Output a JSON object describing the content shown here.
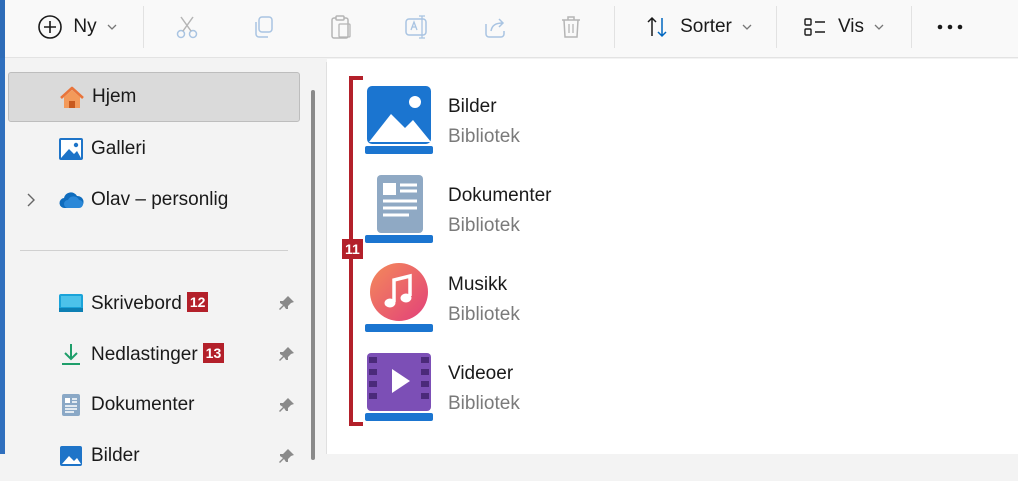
{
  "toolbar": {
    "new_label": "Ny",
    "sort_label": "Sorter",
    "view_label": "Vis",
    "icons": [
      "plus-circle-icon",
      "chevron-down-icon",
      "cut-icon",
      "copy-icon",
      "paste-icon",
      "rename-icon",
      "share-icon",
      "delete-icon",
      "sort-icon",
      "view-icon",
      "more-icon"
    ]
  },
  "sidebar": {
    "items": [
      {
        "label": "Hjem",
        "icon": "home-icon",
        "selected": true
      },
      {
        "label": "Galleri",
        "icon": "gallery-icon"
      },
      {
        "label": "Olav – personlig",
        "icon": "onedrive-icon",
        "expandable": true
      }
    ],
    "pinned": [
      {
        "label": "Skrivebord",
        "icon": "desktop-icon",
        "badge": "12",
        "pinned": true
      },
      {
        "label": "Nedlastinger",
        "icon": "download-icon",
        "badge": "13",
        "pinned": true
      },
      {
        "label": "Dokumenter",
        "icon": "documents-icon",
        "pinned": true
      },
      {
        "label": "Bilder",
        "icon": "pictures-icon",
        "pinned": true
      }
    ]
  },
  "content": {
    "group_badge": "11",
    "libraries": [
      {
        "name": "Bilder",
        "type": "Bibliotek",
        "icon": "pictures-library-icon"
      },
      {
        "name": "Dokumenter",
        "type": "Bibliotek",
        "icon": "documents-library-icon"
      },
      {
        "name": "Musikk",
        "type": "Bibliotek",
        "icon": "music-library-icon"
      },
      {
        "name": "Videoer",
        "type": "Bibliotek",
        "icon": "videos-library-icon"
      }
    ]
  },
  "colors": {
    "accent": "#0067c0",
    "annotation_red": "#b3202a",
    "selected_bg": "#dadada",
    "content_bg": "#ffffff"
  }
}
